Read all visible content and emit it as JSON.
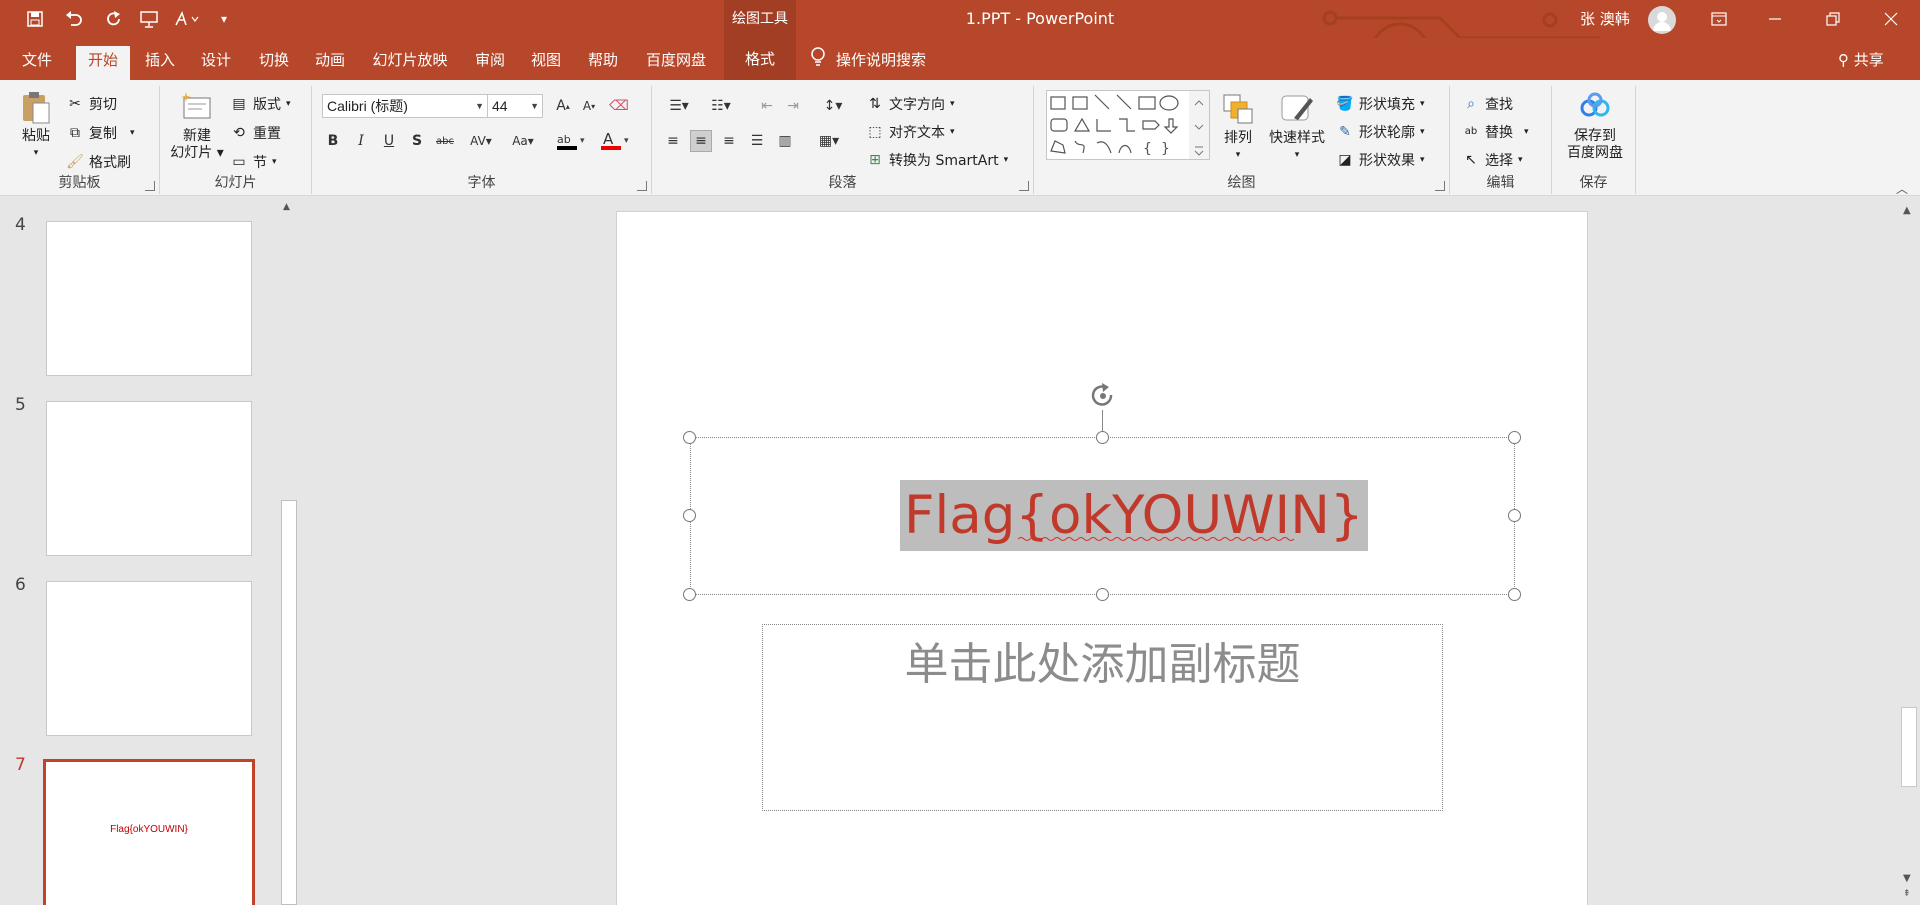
{
  "app": {
    "doc_title": "1.PPT  -  PowerPoint",
    "context_tool_title": "绘图工具",
    "user_name": "张 澳韩",
    "accent": "#b7472a"
  },
  "quick_access": [
    "save-icon",
    "undo-icon",
    "redo-icon",
    "presentation-icon",
    "format-icon",
    "customize-icon"
  ],
  "tabs": [
    {
      "label": "文件"
    },
    {
      "label": "开始",
      "active": true
    },
    {
      "label": "插入"
    },
    {
      "label": "设计"
    },
    {
      "label": "切换"
    },
    {
      "label": "动画"
    },
    {
      "label": "幻灯片放映"
    },
    {
      "label": "审阅"
    },
    {
      "label": "视图"
    },
    {
      "label": "帮助"
    },
    {
      "label": "百度网盘"
    }
  ],
  "context_tab": "格式",
  "tell_me": "操作说明搜索",
  "share": "共享",
  "ribbon": {
    "clipboard": {
      "paste": "粘贴",
      "cut": "剪切",
      "copy": "复制",
      "format_painter": "格式刷",
      "label": "剪贴板"
    },
    "slides": {
      "new_slide_line1": "新建",
      "new_slide_line2": "幻灯片",
      "layout": "版式",
      "reset": "重置",
      "section": "节",
      "label": "幻灯片"
    },
    "font": {
      "name": "Calibri (标题)",
      "size": "44",
      "label": "字体"
    },
    "paragraph": {
      "text_direction": "文字方向",
      "align_text": "对齐文本",
      "convert_smartart": "转换为 SmartArt",
      "label": "段落"
    },
    "drawing": {
      "arrange": "排列",
      "quick_styles": "快速样式",
      "shape_fill": "形状填充",
      "shape_outline": "形状轮廓",
      "shape_effects": "形状效果",
      "label": "绘图"
    },
    "editing": {
      "find": "查找",
      "replace": "替换",
      "select": "选择",
      "label": "编辑"
    },
    "save": {
      "save_line1": "保存到",
      "save_line2": "百度网盘",
      "label": "保存"
    }
  },
  "thumbnails": [
    {
      "number": "4",
      "text": ""
    },
    {
      "number": "5",
      "text": ""
    },
    {
      "number": "6",
      "text": ""
    },
    {
      "number": "7",
      "text": "Flag{okYOUWIN}",
      "selected": true
    }
  ],
  "slide": {
    "title": "Flag{okYOUWIN}",
    "subtitle_placeholder": "单击此处添加副标题",
    "title_color": "#c0392b"
  }
}
